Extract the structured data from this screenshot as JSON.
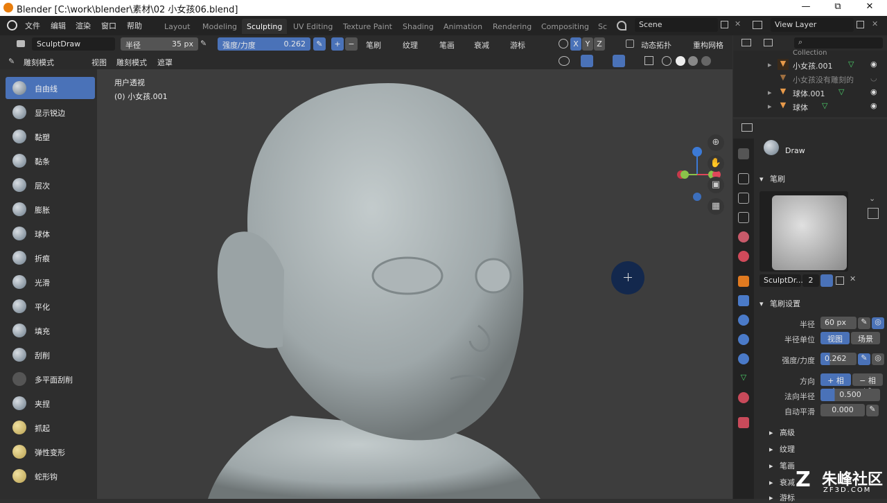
{
  "title": "Blender [C:\\work\\blender\\素材\\02 小女孩06.blend]",
  "window_controls": [
    "—",
    "⧉",
    "✕"
  ],
  "menus": [
    "文件",
    "编辑",
    "渲染",
    "窗口",
    "帮助"
  ],
  "workspaces": [
    "Layout",
    "Modeling",
    "Sculpting",
    "UV Editing",
    "Texture Paint",
    "Shading",
    "Animation",
    "Rendering",
    "Compositing",
    "Sc"
  ],
  "scene": "Scene",
  "view_layer": "View Layer",
  "toolheader": {
    "brush_name": "SculptDraw",
    "radius_label": "半径",
    "radius_value": "35 px",
    "strength_label": "强度/力度",
    "strength_value": "0.262",
    "plus": "+",
    "minus": "−",
    "brush_dd": "笔刷",
    "texture_dd": "纹理",
    "stroke_dd": "笔画",
    "falloff_dd": "衰减",
    "cursor_dd": "游标",
    "x": "X",
    "y": "Y",
    "z": "Z",
    "dyntopo": "动态拓扑",
    "remesh": "重构网格"
  },
  "subheader": {
    "mode": "雕刻模式",
    "view": "视图",
    "sculpt": "雕刻模式",
    "mask": "遮罩"
  },
  "tools": [
    "自由线",
    "显示锐边",
    "黏塑",
    "黏条",
    "层次",
    "膨胀",
    "球体",
    "折痕",
    "光滑",
    "平化",
    "填充",
    "刮削",
    "多平面刮削",
    "夹捏",
    "抓起",
    "弹性变形",
    "蛇形钩"
  ],
  "viewport": {
    "label1": "用户透视",
    "label2": "(0) 小女孩.001",
    "nav_icons": [
      "zoom-icon",
      "hand-icon",
      "camera-icon",
      "grid-icon"
    ]
  },
  "outliner": {
    "collection": "Collection",
    "items": [
      "小女孩.001",
      "小女孩没有雕刻的",
      "球体.001",
      "球体"
    ]
  },
  "properties": {
    "brush_title": "Draw",
    "brush_section": "笔刷",
    "brush_datablock": "SculptDr...",
    "brush_users": "2",
    "settings_section": "笔刷设置",
    "radius_label": "半径",
    "radius_value": "60 px",
    "radius_unit_label": "半径单位",
    "unit_view": "视图",
    "unit_scene": "场景",
    "strength_label": "强度/力度",
    "strength_value": "0.262",
    "direction_label": "方向",
    "dir_add": "+ 相加",
    "dir_sub": "− 相减",
    "normal_radius_label": "法向半径",
    "normal_radius_value": "0.500",
    "autosmooth_label": "自动平滑",
    "autosmooth_value": "0.000",
    "sub_advanced": "高级",
    "sub_texture": "纹理",
    "sub_stroke": "笔画",
    "sub_falloff": "衰减",
    "sub_cursor": "游标"
  },
  "watermark": {
    "brand": "朱峰社区",
    "url": "ZF3D.COM"
  }
}
